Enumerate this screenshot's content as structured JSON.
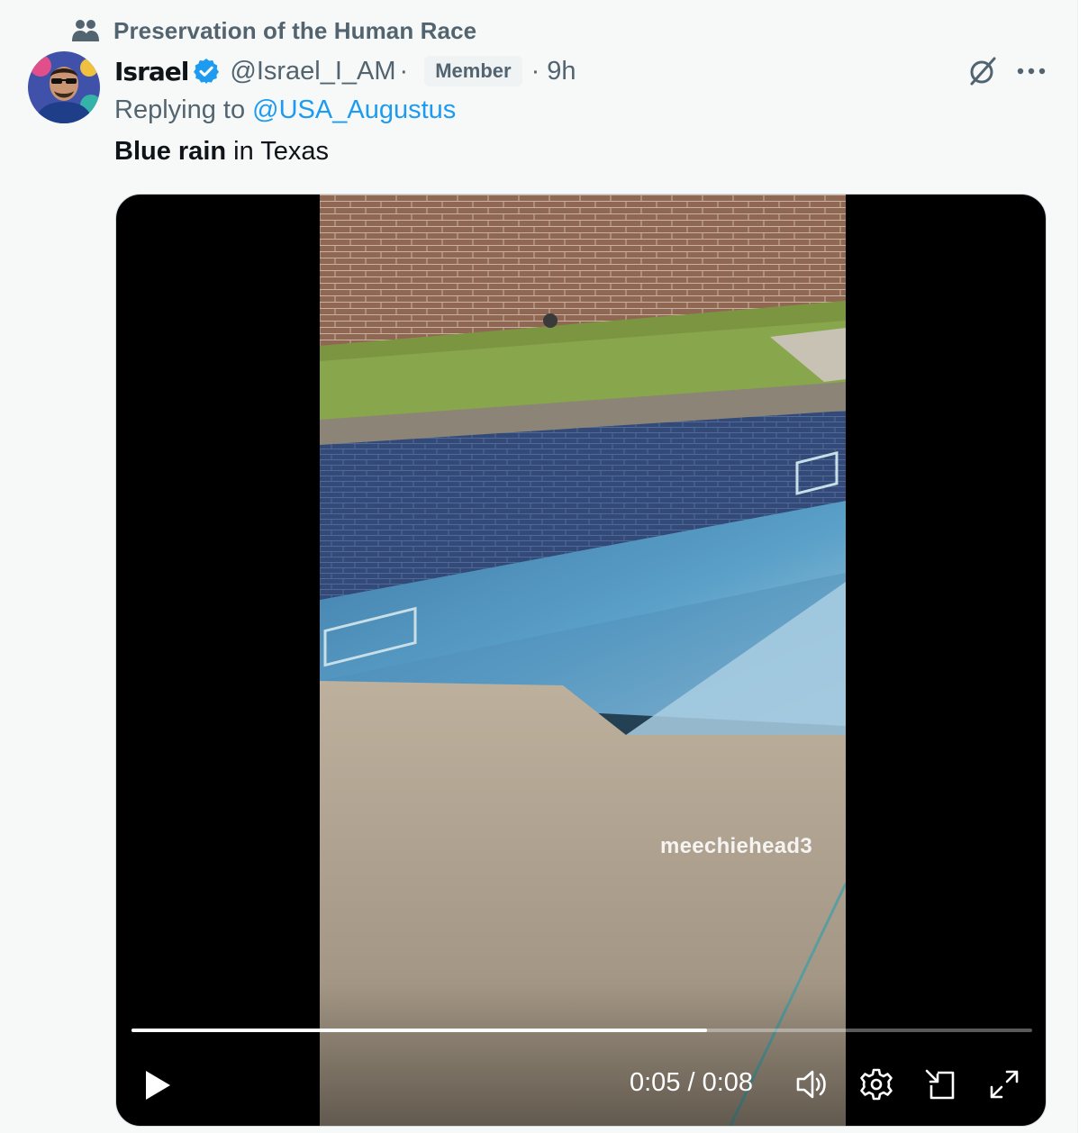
{
  "community": {
    "name": "Preservation of the Human Race",
    "icon": "community-people-icon"
  },
  "author": {
    "display_name": "Israel",
    "handle": "@Israel_I_AM",
    "separator": "·",
    "badge": "Member",
    "time": "· 9h",
    "verified": true
  },
  "reply": {
    "prefix": "Replying to",
    "to": "@USA_Augustus"
  },
  "tweet": {
    "text_bold": "Blue rain",
    "text_rest": " in Texas"
  },
  "video": {
    "watermark": "meechiehead3",
    "time_readout": "0:05 / 0:08",
    "progress_fraction": 0.639
  },
  "actions": {
    "grok_icon": "grok-icon",
    "more_icon": "more-dots-icon",
    "play_icon": "play-icon",
    "volume_icon": "volume-icon",
    "settings_icon": "settings-gear-icon",
    "popout_icon": "picture-in-picture-icon",
    "fullscreen_icon": "fullscreen-icon"
  },
  "colors": {
    "link": "#1d9bf0",
    "secondary_text": "#536471",
    "primary_text": "#0f1419",
    "verified": "#1d9bf0"
  }
}
